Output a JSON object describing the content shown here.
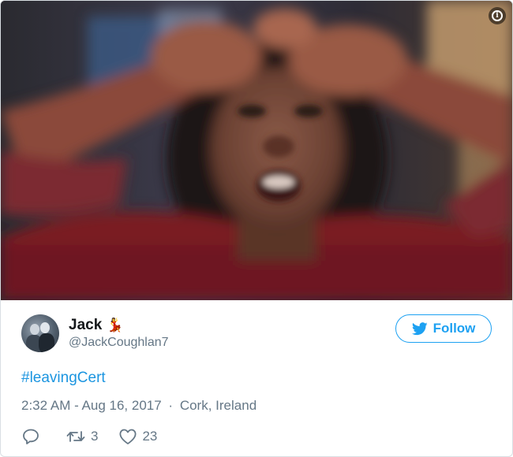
{
  "tweet": {
    "author": {
      "display_name": "Jack",
      "name_emoji": "💃",
      "handle": "@JackCoughlan7"
    },
    "follow_label": "Follow",
    "hashtag": "#leavingCert",
    "time": "2:32 AM - Aug 16, 2017",
    "separator": "·",
    "location": "Cork, Ireland",
    "retweet_count": "3",
    "like_count": "23"
  },
  "icons": {
    "info": "info-icon",
    "bird": "twitter-bird-icon",
    "reply": "reply-icon",
    "retweet": "retweet-icon",
    "like": "heart-icon"
  },
  "colors": {
    "accent": "#1da1f2",
    "link": "#1b95e0",
    "secondary_text": "#657786"
  }
}
